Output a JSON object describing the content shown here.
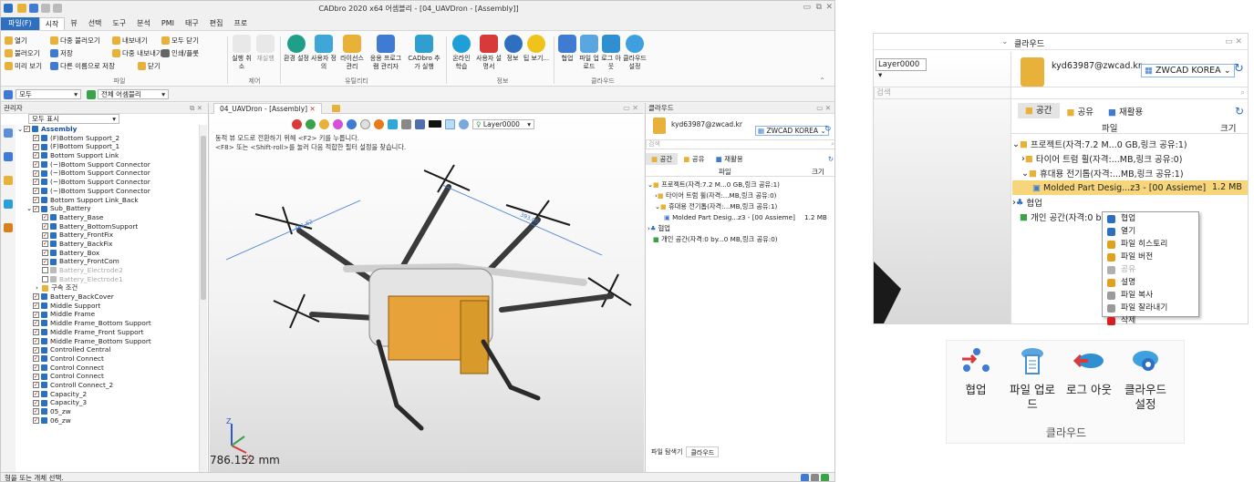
{
  "app": {
    "title": "CADbro 2020 x64    어셈블리 - [04_UAVDron - [Assembly]]",
    "menu": [
      "파일(F)",
      "시작",
      "뷰",
      "선택",
      "도구",
      "분석",
      "PMI",
      "태구",
      "편집",
      "프로"
    ],
    "ribbon": {
      "file_group": {
        "items": [
          "열기",
          "다중 불러오기",
          "내보내기",
          "모두 닫기",
          "불러오기",
          "저장",
          "다중 내보내기",
          "인쇄/플롯",
          "미리 보기",
          "다른 이름으로 저장",
          "닫기"
        ],
        "label": "파일"
      },
      "control_group": {
        "items": [
          "실행 취소",
          "재실행"
        ],
        "label": "제어"
      },
      "utility_group": {
        "items": [
          "환경 설정",
          "사용자 정의",
          "라이선스 관리",
          "응용 프로그램 관리자",
          "CADbro 추가 실행"
        ],
        "label": "유틸리티"
      },
      "info_group": {
        "items": [
          "온라인 학습",
          "사용자 설명서",
          "정보",
          "팁 보기..."
        ],
        "label": "정보"
      },
      "cloud_group": {
        "items": [
          "협업",
          "파일 업로드",
          "로그 아웃",
          "클라우드 설정"
        ],
        "label": "클라우드"
      }
    },
    "row2": {
      "filter": "모두",
      "scope": "전체 어셈블리"
    },
    "left_panel": {
      "title": "관리자",
      "show_filter": "모두 표시",
      "tree": [
        {
          "label": "Assembly",
          "level": 0,
          "checked": true,
          "bold": true
        },
        {
          "label": "(F)Bottom Support_2",
          "level": 1,
          "checked": true
        },
        {
          "label": "(F)Bottom Support_1",
          "level": 1,
          "checked": true
        },
        {
          "label": "Bottom Support Link",
          "level": 1,
          "checked": true
        },
        {
          "label": "(~)Bottom Support Connector",
          "level": 1,
          "checked": true
        },
        {
          "label": "(~)Bottom Support Connector",
          "level": 1,
          "checked": true
        },
        {
          "label": "(~)Bottom Support Connector",
          "level": 1,
          "checked": true
        },
        {
          "label": "(~)Bottom Support Connector",
          "level": 1,
          "checked": true
        },
        {
          "label": "Bottom Support Link_Back",
          "level": 1,
          "checked": true
        },
        {
          "label": "Sub_Battery",
          "level": 1,
          "checked": true
        },
        {
          "label": "Battery_Base",
          "level": 2,
          "checked": true
        },
        {
          "label": "Battery_BottomSupport",
          "level": 2,
          "checked": true
        },
        {
          "label": "Battery_FrontFix",
          "level": 2,
          "checked": true
        },
        {
          "label": "Battery_BackFix",
          "level": 2,
          "checked": true
        },
        {
          "label": "Battery_Box",
          "level": 2,
          "checked": true
        },
        {
          "label": "Battery_FrontCom",
          "level": 2,
          "checked": true
        },
        {
          "label": "Battery_Electrode2",
          "level": 2,
          "checked": false
        },
        {
          "label": "Battery_Electrode1",
          "level": 2,
          "checked": false
        },
        {
          "label": "구속 조건",
          "level": 2,
          "checked": null
        },
        {
          "label": "Battery_BackCover",
          "level": 1,
          "checked": true
        },
        {
          "label": "Middle Support",
          "level": 1,
          "checked": true
        },
        {
          "label": "Middle Frame",
          "level": 1,
          "checked": true
        },
        {
          "label": "Middle Frame_Bottom Support",
          "level": 1,
          "checked": true
        },
        {
          "label": "Middle Frame_Front Support",
          "level": 1,
          "checked": true
        },
        {
          "label": "Middle Frame_Bottom Support",
          "level": 1,
          "checked": true
        },
        {
          "label": "Controlled Central",
          "level": 1,
          "checked": true
        },
        {
          "label": "Control Connect",
          "level": 1,
          "checked": true
        },
        {
          "label": "Control Connect",
          "level": 1,
          "checked": true
        },
        {
          "label": "Control Connect",
          "level": 1,
          "checked": true
        },
        {
          "label": "Controll Connect_2",
          "level": 1,
          "checked": true
        },
        {
          "label": "Capacity_2",
          "level": 1,
          "checked": true
        },
        {
          "label": "Capacity_3",
          "level": 1,
          "checked": true
        },
        {
          "label": "05_zw",
          "level": 1,
          "checked": true
        },
        {
          "label": "06_zw",
          "level": 1,
          "checked": true
        }
      ]
    },
    "viewport": {
      "tab": "04_UAVDron - [Assembly]",
      "layer": "Layer0000",
      "hint1": "동적 뷰 모드로 전환하기 위해 <F2> 키를 누릅니다.",
      "hint2": "<F8> 또는 <Shift-roll>를 눌러 다음 적합한 필터 설정을 찾습니다.",
      "dim1": "461.62",
      "dim2": "393.00",
      "scale": "786.152 mm"
    },
    "status": "형을 또는 개체 선택."
  },
  "cloud_panel": {
    "title": "클라우드",
    "user": "kyd63987@zwcad.kr",
    "org": "ZWCAD KOREA",
    "search_placeholder": "검색",
    "tabs": [
      "공간",
      "공유",
      "재활용"
    ],
    "col_file": "파일",
    "col_size": "크기",
    "rows_small": [
      "프로젝트(자격:7.2 M...0 GB,링크 공유:1)",
      "타이어 트럼 휠(자격:...MB,링크 공유:0)",
      "휴대용 전기톱(자격:...MB,링크 공유:1)",
      "Molded Part Desig...z3 - [00 Assieme]",
      "협업",
      "개인 공간(자격:0 by...0 MB,링크 공유:0)"
    ],
    "size_small": "1.2 MB",
    "bottom_tabs": [
      "파일 탐색기",
      "클라우드"
    ]
  },
  "zoom_panel": {
    "title": "클라우드",
    "layer": "Layer0000",
    "user": "kyd63987@zwcad.kr",
    "org": "ZWCAD KOREA",
    "search_placeholder": "검색",
    "tabs": [
      "공간",
      "공유",
      "재활용"
    ],
    "col_file": "파일",
    "col_size": "크기",
    "rows": [
      "프로젝트(자격:7.2 M...0 GB,링크 공유:1)",
      "타이어 트럼 휠(자격:...MB,링크 공유:0)",
      "휴대용 전기톱(자격:...MB,링크 공유:1)",
      "Molded Part Desig...z3 - [00 Assieme]",
      "협업",
      "개인 공간(자격:0 b"
    ],
    "size": "1.2 MB"
  },
  "context_menu": {
    "items": [
      {
        "label": "협업",
        "enabled": true,
        "color": "#2c6fc1"
      },
      {
        "label": "열기",
        "enabled": true,
        "color": "#2c6fc1"
      },
      {
        "label": "파일 히스토리",
        "enabled": true,
        "color": "#e0a020"
      },
      {
        "label": "파일 버전",
        "enabled": true,
        "color": "#e0a020"
      },
      {
        "label": "공유",
        "enabled": false,
        "color": "#b0b0b0"
      },
      {
        "label": "설명",
        "enabled": true,
        "color": "#e0a020"
      },
      {
        "label": "파일 복사",
        "enabled": true,
        "color": "#9a9a9a"
      },
      {
        "label": "파일 잘라내기",
        "enabled": true,
        "color": "#9a9a9a"
      },
      {
        "label": "삭제",
        "enabled": true,
        "color": "#d81e1e"
      }
    ]
  },
  "cloud_group_zoom": {
    "buttons": [
      "협업",
      "파일 업로드",
      "로그 아웃",
      "클라우드 설정"
    ],
    "label": "클라우드"
  },
  "colors": {
    "accent": "#2f6fbf",
    "selected_row": "#f7d57a",
    "folder": "#e8b13a"
  }
}
